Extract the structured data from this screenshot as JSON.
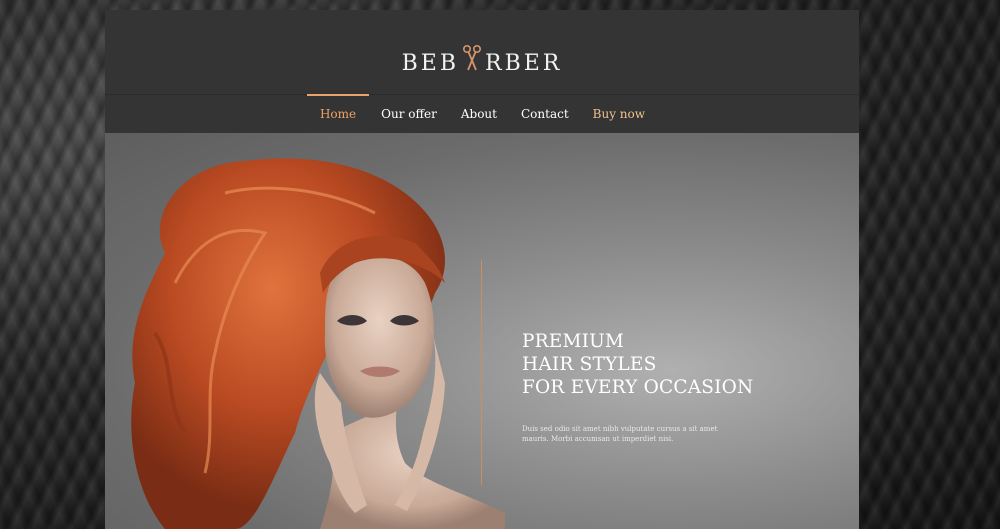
{
  "brand": {
    "name_part1": "BEB",
    "name_part2": "RBER"
  },
  "nav": {
    "items": [
      {
        "label": "Home"
      },
      {
        "label": "Our offer"
      },
      {
        "label": "About"
      },
      {
        "label": "Contact"
      },
      {
        "label": "Buy now"
      }
    ]
  },
  "hero": {
    "headline_line1": "PREMIUM",
    "headline_line2": "HAIR STYLES",
    "headline_line3": "FOR EVERY OCCASION",
    "body": "Duis sed odio sit amet nibh vulputate cursus a sit amet mauris. Morbi accumsan ut imperdiet nisi."
  },
  "colors": {
    "accent": "#e9a26a",
    "header_bg": "#343434",
    "hair": "#c4542a"
  }
}
